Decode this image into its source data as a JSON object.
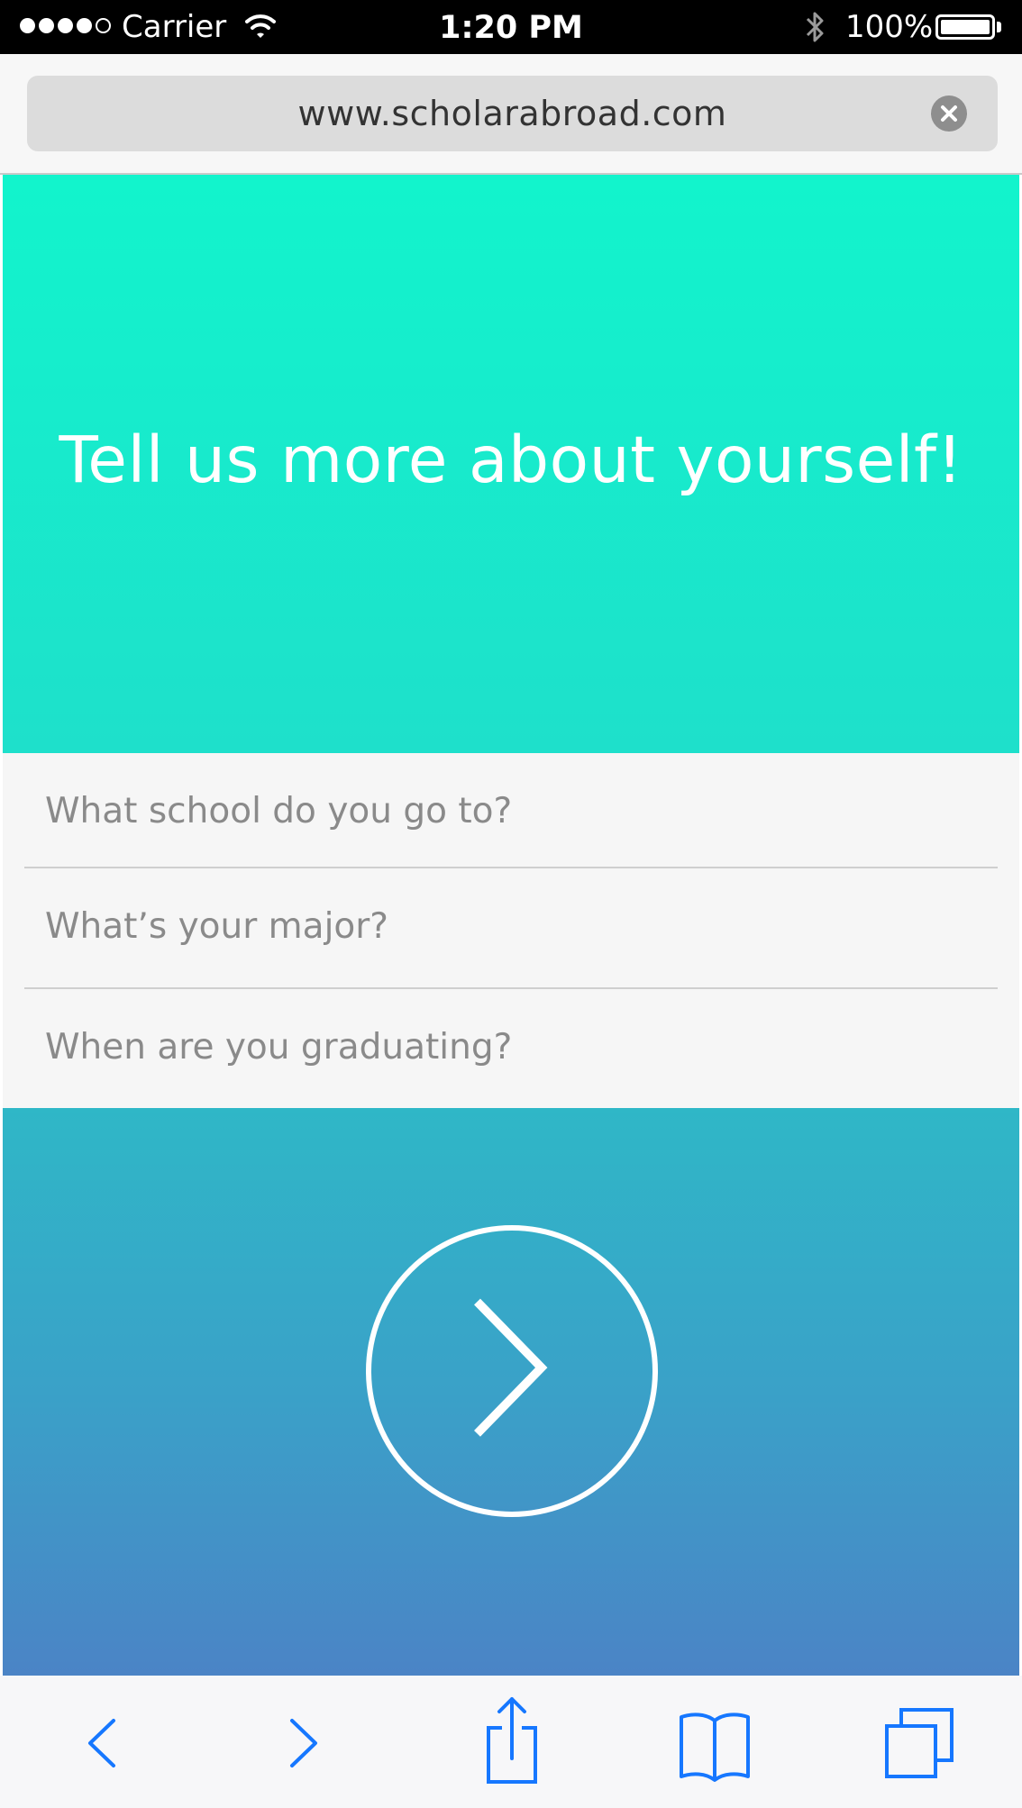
{
  "status_bar": {
    "carrier": "Carrier",
    "time": "1:20 PM",
    "battery": "100%",
    "signal_bars_filled": 4,
    "signal_bars_total": 5
  },
  "browser": {
    "url": "www.scholarabroad.com",
    "clear_icon": "clear-circle-icon"
  },
  "hero": {
    "title": "Tell us more about yourself!",
    "color_top": "#12f4cc",
    "color_bottom": "#1ee0cb"
  },
  "form": {
    "school_placeholder": "What school do you go to?",
    "major_placeholder": "What’s your major?",
    "graduation_placeholder": "When are you graduating?"
  },
  "next": {
    "icon": "chevron-right-circle-icon",
    "color_top": "#2fb7c7",
    "color_bottom": "#4b84c6"
  },
  "toolbar": {
    "icons": [
      "back-arrow-icon",
      "forward-arrow-icon",
      "share-icon",
      "bookmarks-icon",
      "tabs-icon"
    ],
    "accent": "#1677ff"
  }
}
